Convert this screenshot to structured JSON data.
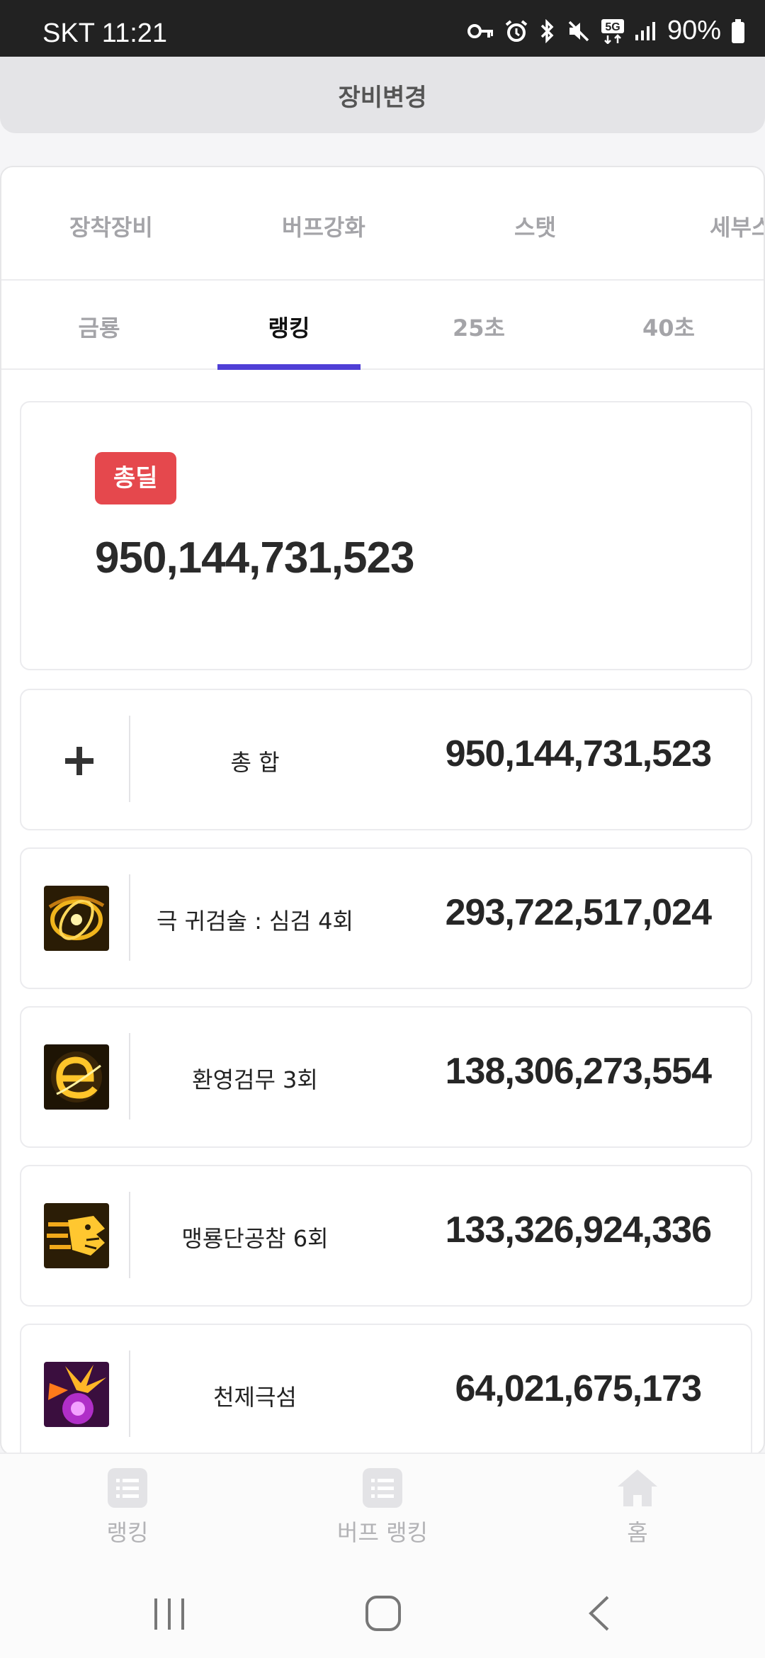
{
  "status_bar": {
    "carrier_time": "SKT 11:21",
    "network": "5G",
    "battery": "90%"
  },
  "header": {
    "title": "장비변경"
  },
  "tabs_primary": [
    {
      "label": "장착장비"
    },
    {
      "label": "버프강화"
    },
    {
      "label": "스탯"
    },
    {
      "label": "세부스"
    }
  ],
  "tabs_secondary": [
    {
      "label": "금룡",
      "active": false
    },
    {
      "label": "랭킹",
      "active": true
    },
    {
      "label": "25초",
      "active": false
    },
    {
      "label": "40초",
      "active": false
    }
  ],
  "summary": {
    "badge": "총딜",
    "value": "950,144,731,523"
  },
  "skills": [
    {
      "name": "총 합",
      "value": "950,144,731,523",
      "icon": "plus-icon"
    },
    {
      "name": "극 귀검술 : 심검 4회",
      "value": "293,722,517,024",
      "icon": "golden-ring-skill-icon"
    },
    {
      "name": "환영검무 3회",
      "value": "138,306,273,554",
      "icon": "golden-e-skill-icon"
    },
    {
      "name": "맹룡단공참 6회",
      "value": "133,326,924,336",
      "icon": "dragon-head-skill-icon"
    },
    {
      "name": "천제극섬",
      "value": "64,021,675,173",
      "icon": "purple-burst-skill-icon"
    }
  ],
  "bottom_nav": [
    {
      "label": "랭킹",
      "icon": "list-icon"
    },
    {
      "label": "버프 랭킹",
      "icon": "list-icon"
    },
    {
      "label": "홈",
      "icon": "home-icon"
    }
  ],
  "colors": {
    "accent": "#4f3fd6",
    "badge": "#e5484d"
  }
}
